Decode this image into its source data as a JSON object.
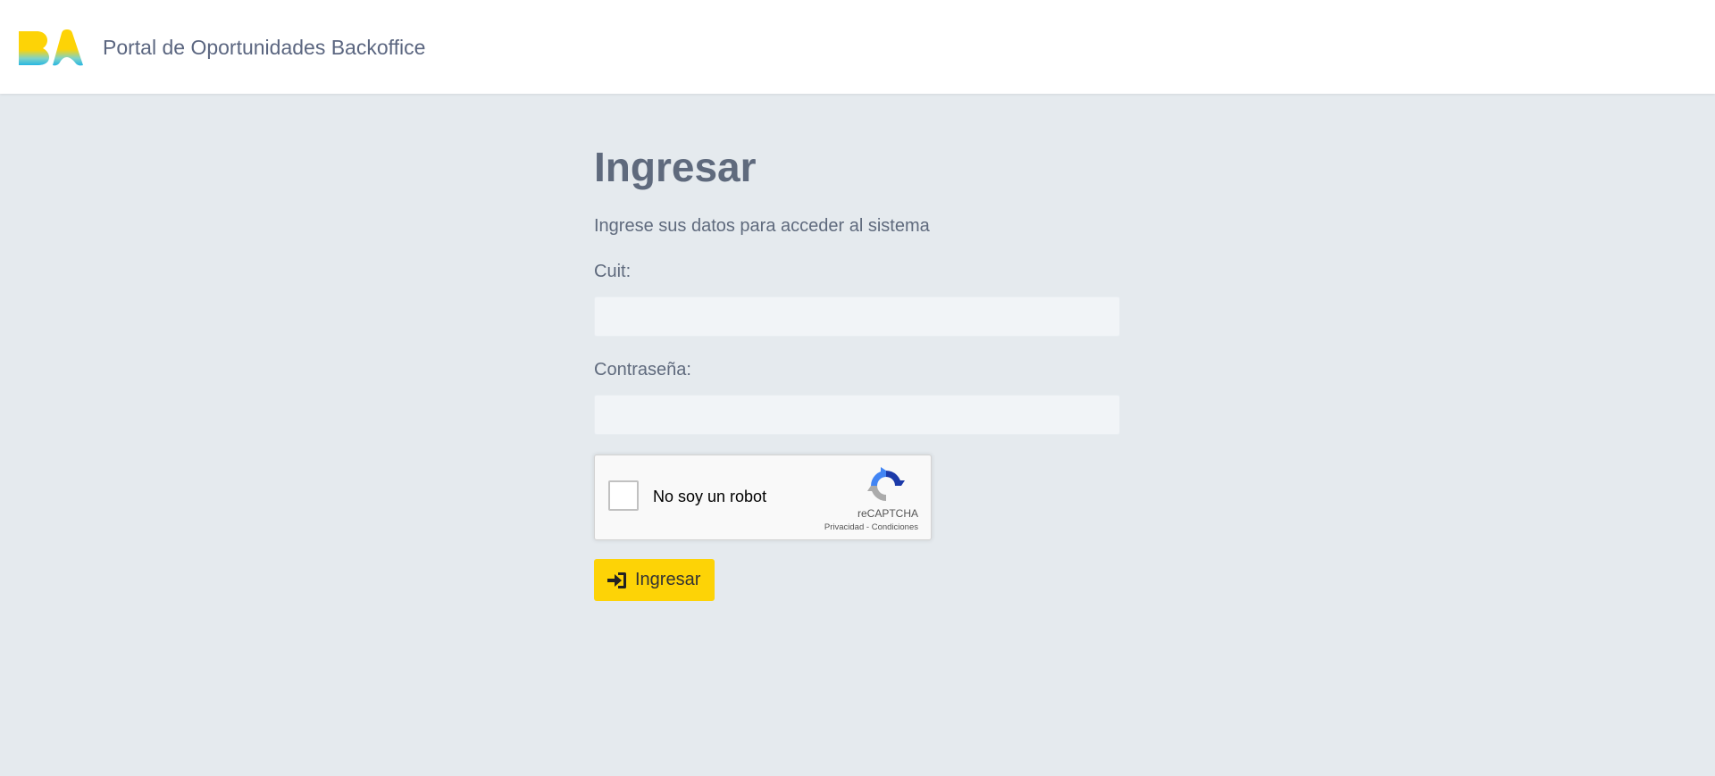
{
  "header": {
    "title": "Portal de Oportunidades Backoffice",
    "logo_icon": "ba-logo-icon"
  },
  "login": {
    "title": "Ingresar",
    "subtitle": "Ingrese sus datos para acceder al sistema",
    "cuit_label": "Cuit:",
    "cuit_value": "",
    "password_label": "Contraseña:",
    "password_value": "",
    "submit_label": "Ingresar",
    "submit_icon": "sign-in-icon"
  },
  "recaptcha": {
    "label": "No soy un robot",
    "brand": "reCAPTCHA",
    "privacy": "Privacidad",
    "separator": " - ",
    "terms": "Condiciones",
    "checked": false
  },
  "colors": {
    "background": "#e5eaee",
    "header": "#ffffff",
    "accent": "#fdd306",
    "text": "#5f6a7d",
    "input_bg": "#f1f4f7"
  }
}
